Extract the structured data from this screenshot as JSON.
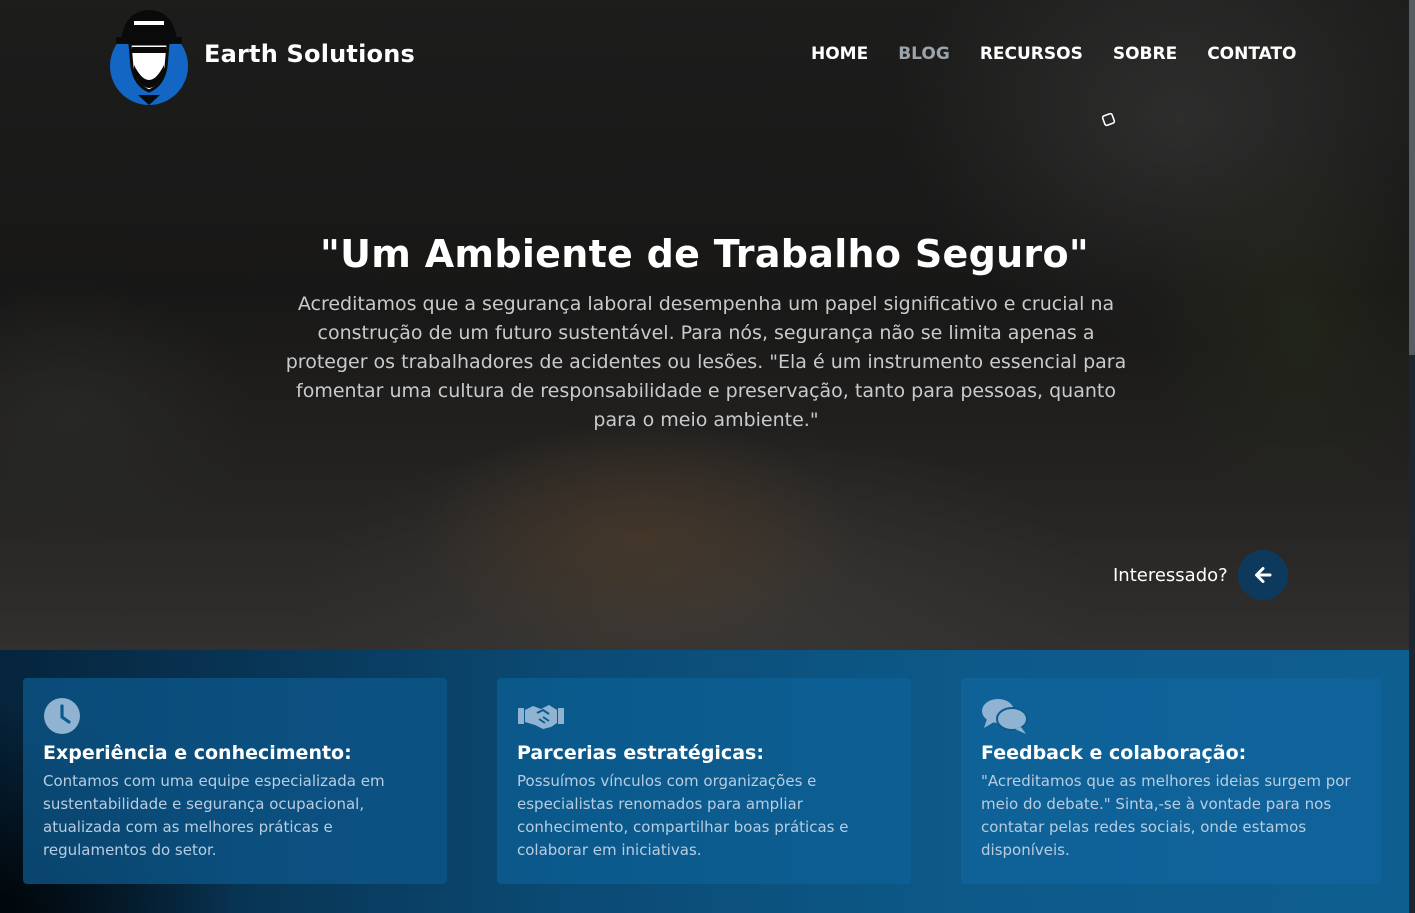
{
  "brand": {
    "name": "Earth Solutions",
    "logo_icon": "worker-helmet-logo"
  },
  "nav": {
    "items": [
      "HOME",
      "BLOG",
      "RECURSOS",
      "SOBRE",
      "CONTATO"
    ],
    "muted_item": "BLOG"
  },
  "hero": {
    "title": "\"Um Ambiente de Trabalho Seguro\"",
    "text": "Acreditamos que a segurança laboral desempenha um papel significativo e crucial na construção de um futuro sustentável. Para nós, segurança não se limita apenas a proteger os trabalhadores de acidentes ou lesões. \"Ela é um instrumento essencial para fomentar uma cultura de responsabilidade e preservação, tanto para pessoas, quanto para o meio ambiente.\"",
    "cta_label": "Interessado?",
    "cta_icon": "arrow-left-icon"
  },
  "features": [
    {
      "icon": "clock-icon",
      "title": "Experiência e conhecimento:",
      "text": "Contamos com uma equipe especializada em sustentabilidade e segurança ocupacional, atualizada com as melhores práticas e regulamentos do setor."
    },
    {
      "icon": "handshake-icon",
      "title": "Parcerias estratégicas:",
      "text": "Possuímos vínculos com organizações e especialistas renomados para ampliar conhecimento, compartilhar boas práticas e colaborar em iniciativas."
    },
    {
      "icon": "comments-icon",
      "title": "Feedback e colaboração:",
      "text": "\"Acreditamos que as melhores ideias surgem por meio do debate.\" Sinta,-se à vontade para nos contatar pelas redes sociais, onde estamos disponíveis."
    }
  ],
  "colors": {
    "accent": "#0d3a5c",
    "card_bg": "#0c5a8e",
    "muted_nav": "#9ba3ab"
  }
}
